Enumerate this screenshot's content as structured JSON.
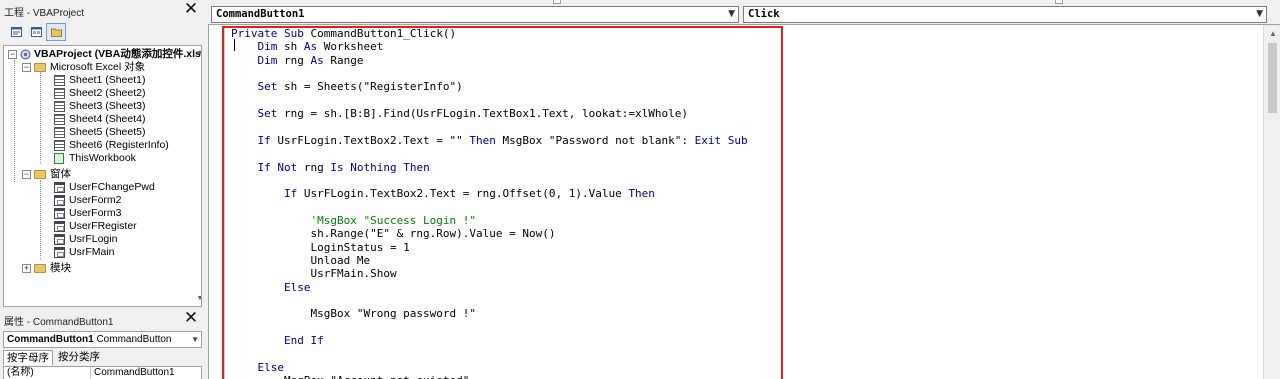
{
  "project_explorer": {
    "title": "工程 - VBAProject",
    "project_label": "VBAProject (VBA动態添加控件.xlsm)",
    "excel_objects_folder": "Microsoft Excel 对象",
    "sheets": [
      "Sheet1 (Sheet1)",
      "Sheet2 (Sheet2)",
      "Sheet3 (Sheet3)",
      "Sheet4 (Sheet4)",
      "Sheet5 (Sheet5)",
      "Sheet6 (RegisterInfo)"
    ],
    "workbook": "ThisWorkbook",
    "forms_folder": "窗体",
    "forms": [
      "UserFChangePwd",
      "UserForm2",
      "UserForm3",
      "UserFRegister",
      "UsrFLogin",
      "UsrFMain"
    ],
    "modules_folder": "模块"
  },
  "properties": {
    "title": "属性 - CommandButton1",
    "object_name": "CommandButton1",
    "object_type": "CommandButton",
    "tab_alpha": "按字母序",
    "tab_category": "按分类序",
    "row_name": "(名称)",
    "row_value": "CommandButton1"
  },
  "code_header": {
    "object_combo": "CommandButton1",
    "procedure_combo": "Click"
  },
  "code_lines": [
    [
      [
        "kw",
        "Private Sub "
      ],
      [
        "",
        "CommandButton1_Click()"
      ]
    ],
    [
      [
        "kw",
        "    Dim "
      ],
      [
        "",
        "sh "
      ],
      [
        "kw",
        "As "
      ],
      [
        "",
        "Worksheet"
      ]
    ],
    [
      [
        "kw",
        "    Dim "
      ],
      [
        "",
        "rng "
      ],
      [
        "kw",
        "As "
      ],
      [
        "",
        "Range"
      ]
    ],
    [],
    [
      [
        "kw",
        "    Set "
      ],
      [
        "",
        "sh = Sheets(\"RegisterInfo\")"
      ]
    ],
    [],
    [
      [
        "kw",
        "    Set "
      ],
      [
        "",
        "rng = sh.[B:B].Find(UsrFLogin.TextBox1.Text, lookat:=xlWhole)"
      ]
    ],
    [],
    [
      [
        "kw",
        "    If "
      ],
      [
        "",
        "UsrFLogin.TextBox2.Text = \"\" "
      ],
      [
        "kw",
        "Then "
      ],
      [
        "",
        "MsgBox \"Password not blank\": "
      ],
      [
        "kw",
        "Exit Sub"
      ]
    ],
    [],
    [
      [
        "kw",
        "    If Not "
      ],
      [
        "",
        "rng "
      ],
      [
        "kw",
        "Is Nothing Then"
      ]
    ],
    [],
    [
      [
        "kw",
        "        If "
      ],
      [
        "",
        "UsrFLogin.TextBox2.Text = rng.Offset(0, 1).Value "
      ],
      [
        "kw",
        "Then"
      ]
    ],
    [],
    [
      [
        "cmt",
        "            'MsgBox \"Success Login !\""
      ]
    ],
    [
      [
        "",
        "            sh.Range(\"E\" & rng.Row).Value = Now()"
      ]
    ],
    [
      [
        "",
        "            LoginStatus = 1"
      ]
    ],
    [
      [
        "",
        "            Unload Me"
      ]
    ],
    [
      [
        "",
        "            UsrFMain.Show"
      ]
    ],
    [
      [
        "kw",
        "        Else"
      ]
    ],
    [],
    [
      [
        "",
        "            MsgBox \"Wrong password !\""
      ]
    ],
    [],
    [
      [
        "kw",
        "        End If"
      ]
    ],
    [],
    [
      [
        "kw",
        "    Else"
      ]
    ],
    [
      [
        "",
        "        MsgBox \"Account not existed\""
      ]
    ]
  ],
  "colors": {
    "keyword": "#00008b",
    "comment": "#008000",
    "highlight_border": "#e01f1f"
  }
}
